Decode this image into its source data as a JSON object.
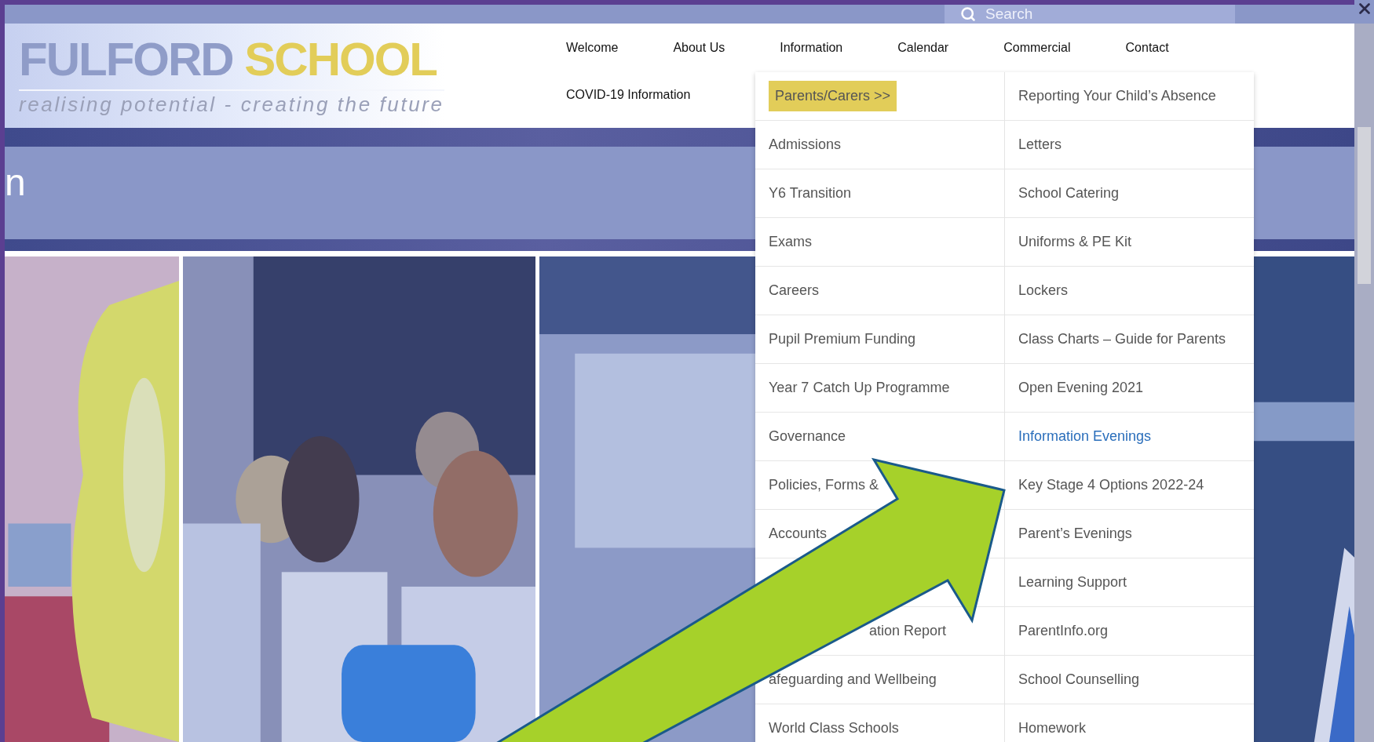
{
  "search": {
    "placeholder": "Search"
  },
  "logo": {
    "name_first": "FULFORD",
    "name_second": "SCHOOL",
    "tagline": "realising potential - creating the future"
  },
  "nav": {
    "rows": [
      [
        "Welcome",
        "About Us",
        "Information",
        "Calendar",
        "Commercial",
        "Contact"
      ],
      [
        "COVID-19 Information"
      ]
    ]
  },
  "page_title": "n",
  "dropdown": {
    "columns": [
      [
        {
          "kind": "item",
          "label": "Parents/Carers >>",
          "selected": true
        },
        {
          "kind": "item",
          "label": "Admissions",
          "selected": false
        },
        {
          "kind": "item",
          "label": "Y6 Transition",
          "selected": false
        },
        {
          "kind": "item",
          "label": "Exams",
          "selected": false
        },
        {
          "kind": "item",
          "label": "Careers",
          "selected": false
        },
        {
          "kind": "item",
          "label": "Pupil Premium Funding",
          "selected": false
        },
        {
          "kind": "item",
          "label": "Year 7 Catch Up Programme",
          "selected": false
        },
        {
          "kind": "item",
          "label": "Governance",
          "selected": false
        },
        {
          "kind": "item",
          "label": "Policies, Forms &",
          "selected": false
        },
        {
          "kind": "item",
          "label": "Accounts",
          "selected": false
        },
        {
          "kind": "covered"
        },
        {
          "kind": "tail",
          "label": "ation Report",
          "selected": false
        },
        {
          "kind": "item",
          "label": "afeguarding and Wellbeing",
          "selected": false
        },
        {
          "kind": "item",
          "label": "World Class Schools",
          "selected": false
        }
      ],
      [
        {
          "kind": "item",
          "label": "Reporting Your Child’s Absence",
          "selected": false
        },
        {
          "kind": "item",
          "label": "Letters",
          "selected": false
        },
        {
          "kind": "item",
          "label": "School Catering",
          "selected": false
        },
        {
          "kind": "item",
          "label": "Uniforms & PE Kit",
          "selected": false
        },
        {
          "kind": "item",
          "label": "Lockers",
          "selected": false
        },
        {
          "kind": "item",
          "label": "Class Charts – Guide for Parents",
          "selected": false
        },
        {
          "kind": "item",
          "label": "Open Evening 2021",
          "selected": false
        },
        {
          "kind": "item",
          "label": "Information Evenings",
          "selected": true
        },
        {
          "kind": "item",
          "label": "Key Stage 4 Options 2022-24",
          "selected": false
        },
        {
          "kind": "item",
          "label": "Parent’s Evenings",
          "selected": false
        },
        {
          "kind": "item",
          "label": "Learning Support",
          "selected": false
        },
        {
          "kind": "item",
          "label": "ParentInfo.org",
          "selected": false
        },
        {
          "kind": "item",
          "label": "School Counselling",
          "selected": false
        },
        {
          "kind": "item",
          "label": "Homework",
          "selected": false
        }
      ]
    ]
  }
}
